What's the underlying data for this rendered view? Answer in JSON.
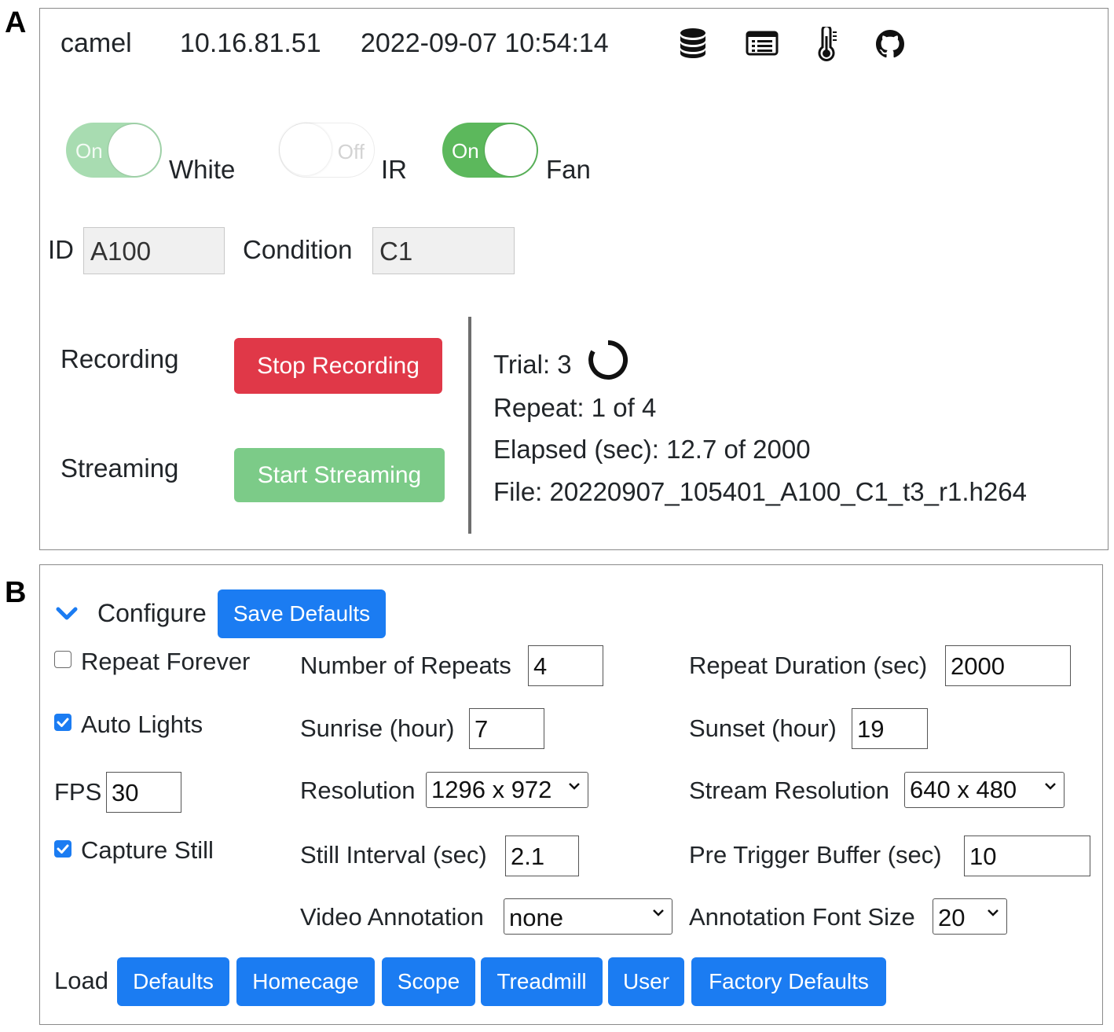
{
  "panel_a": {
    "letter": "A",
    "header": {
      "hostname": "camel",
      "ip": "10.16.81.51",
      "datetime": "2022-09-07 10:54:14",
      "icons": [
        "database-icon",
        "list-icon",
        "thermometer-icon",
        "github-icon"
      ]
    },
    "toggles": [
      {
        "name": "White",
        "state_label": "On",
        "on": true
      },
      {
        "name": "IR",
        "state_label": "Off",
        "on": false
      },
      {
        "name": "Fan",
        "state_label": "On",
        "on": true
      }
    ],
    "fields": {
      "id_label": "ID",
      "id_value": "A100",
      "condition_label": "Condition",
      "condition_value": "C1"
    },
    "recording": {
      "label": "Recording",
      "button": "Stop Recording"
    },
    "streaming": {
      "label": "Streaming",
      "button": "Start Streaming"
    },
    "status": {
      "trial": "Trial: 3",
      "repeat": "Repeat: 1 of 4",
      "elapsed": "Elapsed (sec): 12.7 of 2000",
      "file": "File: 20220907_105401_A100_C1_t3_r1.h264"
    },
    "colors": {
      "stop_button": "#e03848",
      "start_button": "#7ccb88",
      "toggle_on": "#5cb85c"
    }
  },
  "panel_b": {
    "letter": "B",
    "configure_label": "Configure",
    "save_defaults": "Save Defaults",
    "repeat_forever": {
      "label": "Repeat Forever",
      "checked": false
    },
    "number_of_repeats": {
      "label": "Number of Repeats",
      "value": "4"
    },
    "repeat_duration": {
      "label": "Repeat Duration (sec)",
      "value": "2000"
    },
    "auto_lights": {
      "label": "Auto Lights",
      "checked": true
    },
    "sunrise": {
      "label": "Sunrise (hour)",
      "value": "7"
    },
    "sunset": {
      "label": "Sunset (hour)",
      "value": "19"
    },
    "fps": {
      "label": "FPS",
      "value": "30"
    },
    "resolution": {
      "label": "Resolution",
      "value": "1296 x 972"
    },
    "stream_resolution": {
      "label": "Stream Resolution",
      "value": "640 x 480"
    },
    "capture_still": {
      "label": "Capture Still",
      "checked": true
    },
    "still_interval": {
      "label": "Still Interval (sec)",
      "value": "2.1"
    },
    "pre_trigger_buffer": {
      "label": "Pre Trigger Buffer (sec)",
      "value": "10"
    },
    "video_annotation": {
      "label": "Video Annotation",
      "value": "none"
    },
    "annotation_font_size": {
      "label": "Annotation Font Size",
      "value": "20"
    },
    "load": {
      "label": "Load",
      "buttons": [
        "Defaults",
        "Homecage",
        "Scope",
        "Treadmill",
        "User",
        "Factory Defaults"
      ]
    },
    "colors": {
      "primary": "#1b7cf2"
    }
  }
}
